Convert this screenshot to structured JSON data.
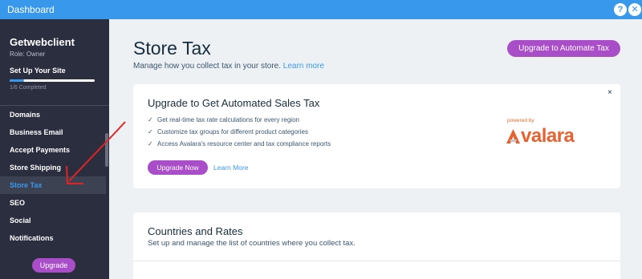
{
  "topbar": {
    "title": "Dashboard",
    "help": "?",
    "close": "✕"
  },
  "sidebar": {
    "site_name": "Getwebclient",
    "role": "Role: Owner",
    "setup_title": "Set Up Your Site",
    "setup_progress": 0.167,
    "setup_completed": "1/6 Completed",
    "items": [
      {
        "label": "Domains"
      },
      {
        "label": "Business Email"
      },
      {
        "label": "Accept Payments"
      },
      {
        "label": "Store Shipping"
      },
      {
        "label": "Store Tax"
      },
      {
        "label": "SEO"
      },
      {
        "label": "Social"
      },
      {
        "label": "Notifications"
      }
    ],
    "upgrade_label": "Upgrade"
  },
  "main": {
    "title": "Store Tax",
    "subtitle": "Manage how you collect tax in your store.",
    "subtitle_link": "Learn more",
    "automate_button": "Upgrade to Automate Tax",
    "promo": {
      "heading": "Upgrade to Get Automated Sales Tax",
      "bullets": [
        "Get real-time tax rate calculations for every region",
        "Customize tax groups for different product categories",
        "Access Avalara's resource center and tax compliance reports"
      ],
      "check_icon": "✓",
      "upgrade_now": "Upgrade Now",
      "learn_more": "Learn More",
      "powered_by": "powered by",
      "brand": "valara",
      "close": "×"
    },
    "countries": {
      "heading": "Countries and Rates",
      "subtitle": "Set up and manage the list of countries where you collect tax."
    }
  },
  "colors": {
    "topbar": "#3899ec",
    "sidebar": "#2b2e3f",
    "accent_purple": "#aa4dc8",
    "link_blue": "#3899ec",
    "avalara_orange": "#e8622f",
    "annotation_red": "#e02424"
  }
}
